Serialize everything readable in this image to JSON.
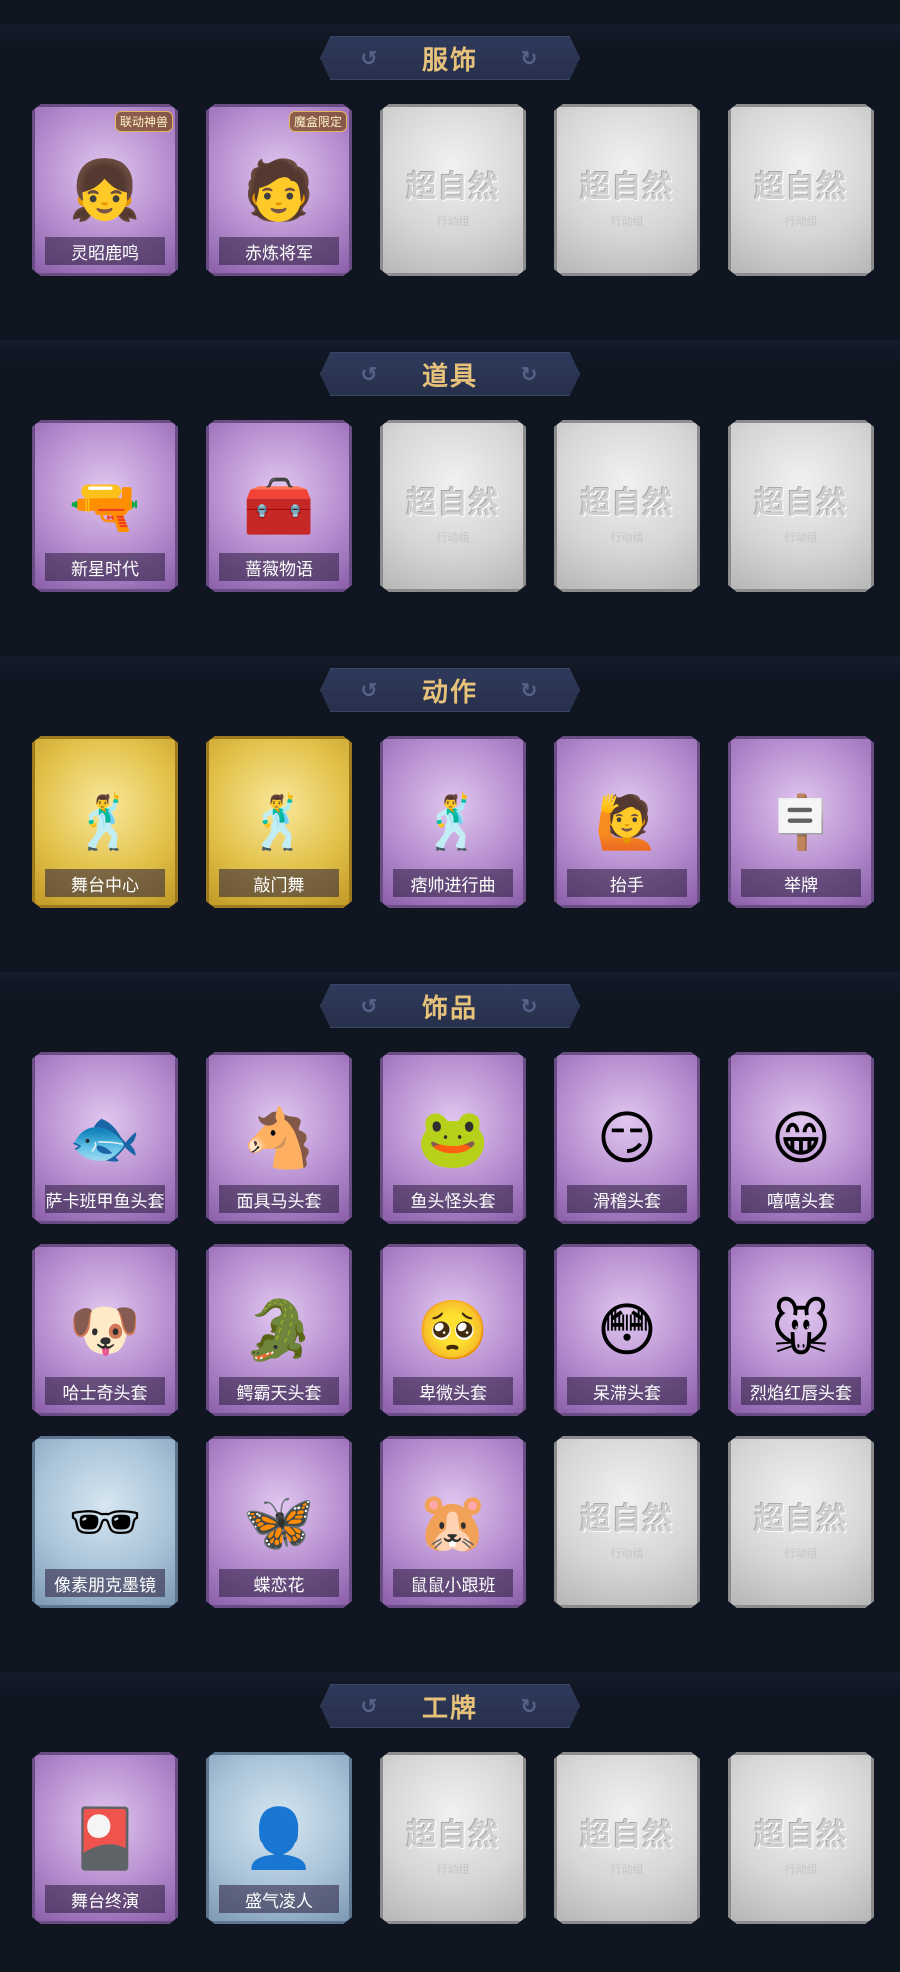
{
  "sections": [
    {
      "title": "服饰",
      "items": [
        {
          "name": "灵昭鹿鸣",
          "rarity": "purple",
          "icon": "costume-lingzhao-icon",
          "badge": "联动神兽"
        },
        {
          "name": "赤炼将军",
          "rarity": "purple",
          "icon": "costume-general-icon",
          "badge": "魔盒限定"
        },
        {
          "name": "",
          "rarity": "empty",
          "icon": "locked-slot-icon"
        },
        {
          "name": "",
          "rarity": "empty",
          "icon": "locked-slot-icon"
        },
        {
          "name": "",
          "rarity": "empty",
          "icon": "locked-slot-icon"
        }
      ]
    },
    {
      "title": "道具",
      "items": [
        {
          "name": "新星时代",
          "rarity": "purple",
          "icon": "revolver-icon"
        },
        {
          "name": "蔷薇物语",
          "rarity": "purple",
          "icon": "medkit-icon"
        },
        {
          "name": "",
          "rarity": "empty",
          "icon": "locked-slot-icon"
        },
        {
          "name": "",
          "rarity": "empty",
          "icon": "locked-slot-icon"
        },
        {
          "name": "",
          "rarity": "empty",
          "icon": "locked-slot-icon"
        }
      ]
    },
    {
      "title": "动作",
      "items": [
        {
          "name": "舞台中心",
          "rarity": "gold",
          "icon": "dance-pose-icon"
        },
        {
          "name": "敲门舞",
          "rarity": "gold",
          "icon": "dance-pose-icon"
        },
        {
          "name": "痞帅进行曲",
          "rarity": "purple",
          "icon": "dance-pose-icon"
        },
        {
          "name": "抬手",
          "rarity": "purple",
          "icon": "raise-hand-icon"
        },
        {
          "name": "举牌",
          "rarity": "purple",
          "icon": "hold-sign-icon"
        }
      ]
    },
    {
      "title": "饰品",
      "items": [
        {
          "name": "萨卡班甲鱼头套",
          "rarity": "purple",
          "icon": "fish-head-icon"
        },
        {
          "name": "面具马头套",
          "rarity": "purple",
          "icon": "horse-head-icon"
        },
        {
          "name": "鱼头怪头套",
          "rarity": "purple",
          "icon": "fish-monster-head-icon"
        },
        {
          "name": "滑稽头套",
          "rarity": "purple",
          "icon": "smirk-face-icon"
        },
        {
          "name": "嘻嘻头套",
          "rarity": "purple",
          "icon": "grin-face-icon"
        },
        {
          "name": "哈士奇头套",
          "rarity": "purple",
          "icon": "husky-head-icon"
        },
        {
          "name": "鳄霸天头套",
          "rarity": "purple",
          "icon": "crocodile-head-icon"
        },
        {
          "name": "卑微头套",
          "rarity": "purple",
          "icon": "pleading-face-icon"
        },
        {
          "name": "呆滞头套",
          "rarity": "purple",
          "icon": "dazed-face-icon"
        },
        {
          "name": "烈焰红唇头套",
          "rarity": "purple",
          "icon": "pikachu-head-icon"
        },
        {
          "name": "像素朋克墨镜",
          "rarity": "blue",
          "icon": "pixel-sunglasses-icon"
        },
        {
          "name": "蝶恋花",
          "rarity": "purple",
          "icon": "butterfly-ornament-icon"
        },
        {
          "name": "鼠鼠小跟班",
          "rarity": "purple",
          "icon": "hamster-icon"
        },
        {
          "name": "",
          "rarity": "empty",
          "icon": "locked-slot-icon"
        },
        {
          "name": "",
          "rarity": "empty",
          "icon": "locked-slot-icon"
        }
      ]
    },
    {
      "title": "工牌",
      "items": [
        {
          "name": "舞台终演",
          "rarity": "purple",
          "icon": "badge-card-stage-icon"
        },
        {
          "name": "盛气凌人",
          "rarity": "blue",
          "icon": "badge-card-silhouette-icon"
        },
        {
          "name": "",
          "rarity": "empty",
          "icon": "locked-slot-icon"
        },
        {
          "name": "",
          "rarity": "empty",
          "icon": "locked-slot-icon"
        },
        {
          "name": "",
          "rarity": "empty",
          "icon": "locked-slot-icon"
        }
      ]
    }
  ],
  "empty_slot_logo": "超自然",
  "empty_slot_sub": "行动组",
  "glyphs": {
    "fish-head-icon": "🐟",
    "horse-head-icon": "🐴",
    "fish-monster-head-icon": "🐸",
    "smirk-face-icon": "😏",
    "grin-face-icon": "😁",
    "husky-head-icon": "🐶",
    "crocodile-head-icon": "🐊",
    "pleading-face-icon": "🥺",
    "dazed-face-icon": "😳",
    "pikachu-head-icon": "🐭",
    "pixel-sunglasses-icon": "🕶",
    "butterfly-ornament-icon": "🦋",
    "hamster-icon": "🐹",
    "revolver-icon": "🔫",
    "medkit-icon": "🧰",
    "dance-pose-icon": "🕺",
    "raise-hand-icon": "🙋",
    "hold-sign-icon": "🪧",
    "costume-lingzhao-icon": "👧",
    "costume-general-icon": "🧑",
    "badge-card-stage-icon": "🎴",
    "badge-card-silhouette-icon": "👤"
  }
}
